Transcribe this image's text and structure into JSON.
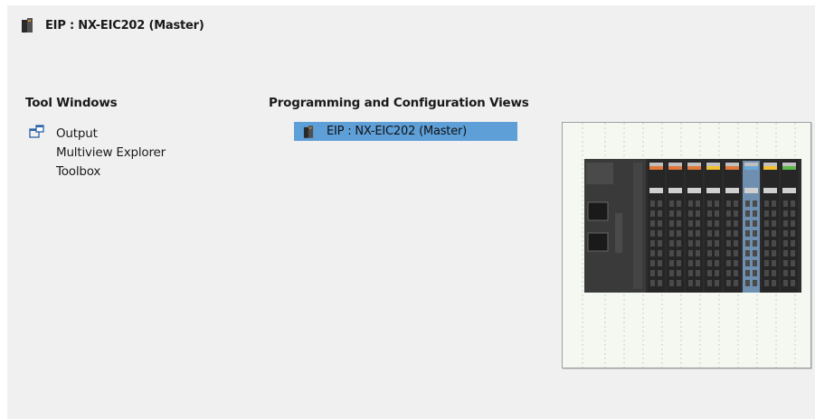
{
  "header": {
    "title": "EIP : NX-EIC202 (Master)",
    "icon": "device-unit-icon"
  },
  "tool_windows": {
    "heading": "Tool Windows",
    "items": [
      {
        "label": "Output",
        "icon": "float-window-icon"
      },
      {
        "label": "Multiview Explorer"
      },
      {
        "label": "Toolbox"
      }
    ]
  },
  "programming_views": {
    "heading": "Programming and Configuration Views",
    "items": [
      {
        "label": "EIP : NX-EIC202 (Master)",
        "icon": "device-unit-icon",
        "selected": true
      }
    ]
  },
  "preview": {
    "name": "device-thumbnail",
    "slice_colors": [
      "#e0783a",
      "#e0783a",
      "#e0783a",
      "#f0c030",
      "#e0783a",
      "#6aa8d8",
      "#f0c030",
      "#5bb84a"
    ]
  },
  "colors": {
    "panel_bg": "#f0f0f0",
    "selection": "#5e9fd8"
  }
}
